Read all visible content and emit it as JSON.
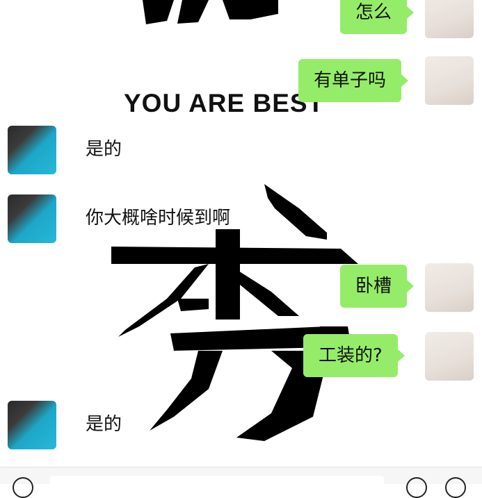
{
  "wallpaper": {
    "english_text": "YOU ARE BEST",
    "big_glyph": "秀"
  },
  "messages": [
    {
      "side": "me",
      "text": "怎么"
    },
    {
      "side": "me",
      "text": "有单子吗"
    },
    {
      "side": "other",
      "text": "是的"
    },
    {
      "side": "other",
      "text": "你大概啥时候到啊"
    },
    {
      "side": "me",
      "text": "卧槽"
    },
    {
      "side": "me",
      "text": "工装的?"
    },
    {
      "side": "other",
      "text": "是的"
    }
  ],
  "colors": {
    "outgoing_bubble": "#95ec69",
    "background": "#ffffff"
  }
}
